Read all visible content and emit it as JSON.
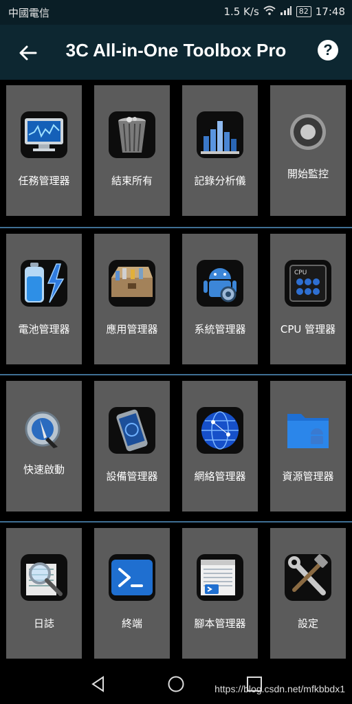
{
  "status": {
    "carrier": "中國電信",
    "speed": "1.5 K/s",
    "battery": "82",
    "time": "17:48"
  },
  "appbar": {
    "title": "3C All-in-One Toolbox Pro",
    "help": "?"
  },
  "tiles": [
    {
      "label": "任務管理器",
      "icon": "monitor-chart-icon"
    },
    {
      "label": "結束所有",
      "icon": "trash-can-icon"
    },
    {
      "label": "記錄分析儀",
      "icon": "bar-chart-icon"
    },
    {
      "label": "開始監控",
      "icon": "record-button-icon"
    },
    {
      "label": "電池管理器",
      "icon": "battery-lightning-icon"
    },
    {
      "label": "應用管理器",
      "icon": "toolbox-icon"
    },
    {
      "label": "系統管理器",
      "icon": "android-gear-icon"
    },
    {
      "label": "CPU 管理器",
      "icon": "cpu-chip-icon"
    },
    {
      "label": "快速啟動",
      "icon": "rocket-launch-icon"
    },
    {
      "label": "設備管理器",
      "icon": "smartphone-icon"
    },
    {
      "label": "網絡管理器",
      "icon": "globe-network-icon"
    },
    {
      "label": "資源管理器",
      "icon": "folder-android-icon"
    },
    {
      "label": "日誌",
      "icon": "magnifier-log-icon"
    },
    {
      "label": "終端",
      "icon": "terminal-icon"
    },
    {
      "label": "腳本管理器",
      "icon": "script-icon"
    },
    {
      "label": "設定",
      "icon": "wrench-hammer-icon"
    }
  ],
  "watermark": "https://blog.csdn.net/mfkbbdx1",
  "colors": {
    "appbar": "#0d2731",
    "tile": "#5b5b5b",
    "separator": "#3f6f94"
  }
}
